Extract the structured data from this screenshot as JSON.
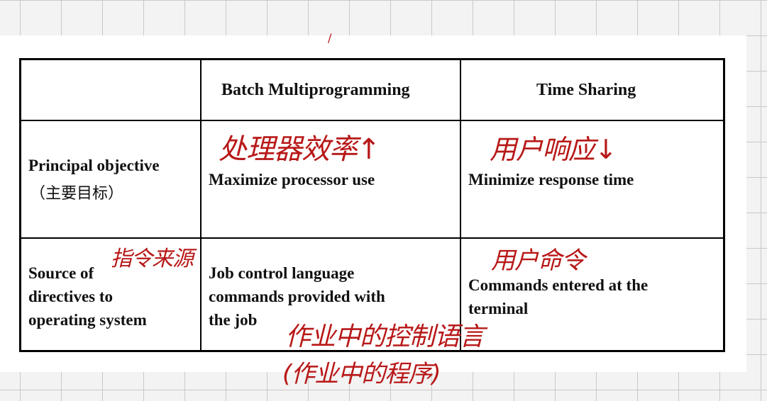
{
  "table": {
    "header": {
      "col1": "",
      "col2": "Batch Multiprogramming",
      "col3": "Time Sharing"
    },
    "rows": [
      {
        "label": "Principal objective",
        "label_cn": "（主要目标）",
        "batch": "Maximize processor use",
        "timesharing": "Minimize response time"
      },
      {
        "label": "Source of\ndirectives to\noperating system",
        "batch": "Job control language\ncommands provided with\nthe job",
        "timesharing": "Commands entered at the\nterminal"
      }
    ]
  },
  "annotations": {
    "row1_batch": "处理器效率↑",
    "row1_timesharing": "用户响应↓",
    "row2_label": "指令来源",
    "row2_timesharing": "用户命令",
    "row2_batch_line1": "作业中的控制语言",
    "row2_batch_line2": "(作业中的程序)"
  },
  "colors": {
    "ink": "#b81818",
    "text": "#111111",
    "grid": "#c9c9c9"
  }
}
